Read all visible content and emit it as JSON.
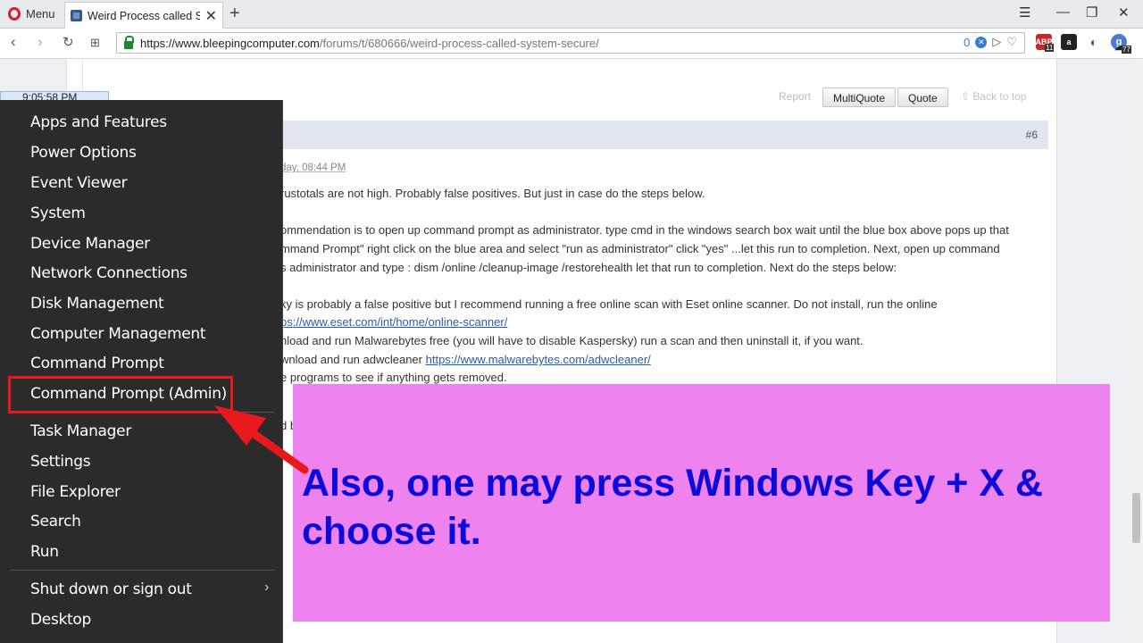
{
  "browser": {
    "menu_label": "Menu",
    "tab_title": "Weird Process called Syste",
    "url_host": "https://www.bleepingcomputer.com",
    "url_path": "/forums/t/680666/weird-process-called-system-secure/",
    "url_badge_count": "0",
    "ext_abp_count": "11",
    "ext_other_count": "77"
  },
  "post": {
    "report_label": "Report",
    "multiquote_label": "MultiQuote",
    "quote_label": "Quote",
    "back_to_top_label": "Back to top",
    "post_number": "#6",
    "date": "day, 08:44 PM",
    "lines": [
      "rustotals are not high. Probably false positives. But just in case do the steps below.",
      "ommendation is to open up command prompt as administrator. type cmd in the windows search box wait until the blue box above pops up that",
      "mmand Prompt\" right click on the blue area and select \"run as administrator\" click \"yes\" ...let this run to completion. Next, open up command",
      "s administrator and type : dism /online /cleanup-image /restorehealth   let that run to completion. Next do the steps below:",
      "ky is probably a false positive but I recommend running a free online scan with Eset online scanner. Do not install, run the online",
      "nload and run Malwarebytes free (you will have to disable Kaspersky) run a scan and then uninstall it, if you want.",
      "wnload and run adwcleaner ",
      "e programs to see if anything gets removed."
    ],
    "link_eset": "ps://www.eset.com/int/home/online-scanner/",
    "link_adw": "https://www.malwarebytes.com/adwcleaner/",
    "stray": "d b"
  },
  "taskbar_time": "9:05:58 PM",
  "winx_menu": {
    "items": [
      "Apps and Features",
      "Power Options",
      "Event Viewer",
      "System",
      "Device Manager",
      "Network Connections",
      "Disk Management",
      "Computer Management",
      "Command Prompt",
      "Command Prompt (Admin)",
      "Task Manager",
      "Settings",
      "File Explorer",
      "Search",
      "Run",
      "Shut down or sign out",
      "Desktop"
    ]
  },
  "annotation": {
    "text": "Also, one may press Windows Key + X & choose it.",
    "text_color": "#0c0cda",
    "background": "#ee82ee",
    "highlight_color": "#e8191d"
  }
}
